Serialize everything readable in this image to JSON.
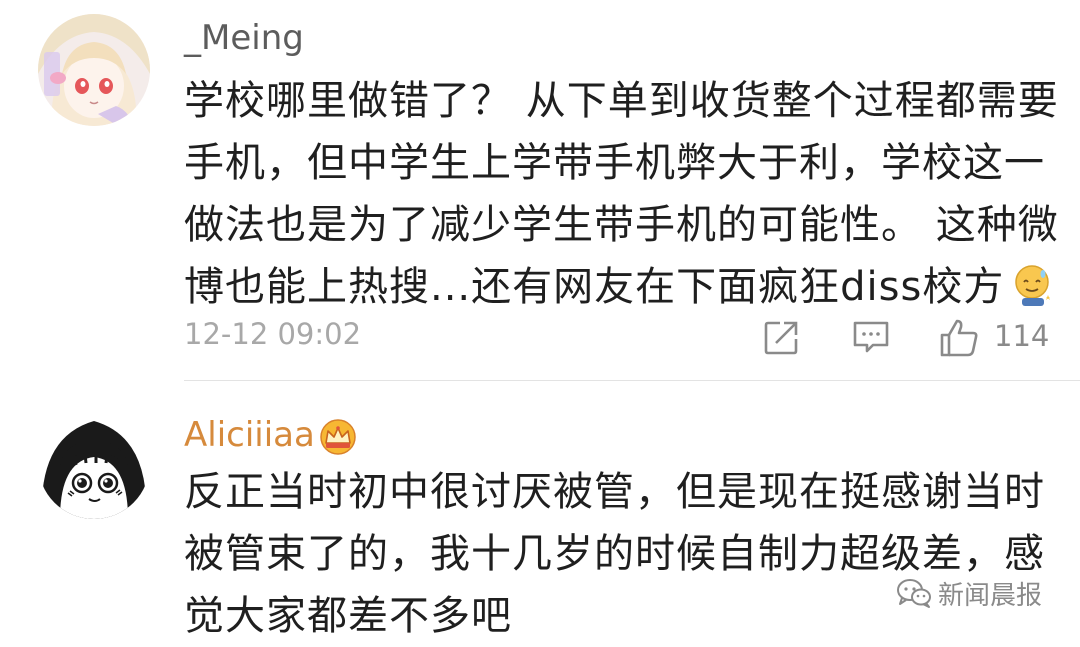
{
  "comments": [
    {
      "username": "_Meing",
      "text_lines": [
        "学校哪里做错了？ 从下单到收货整个过程都需要",
        "手机，但中学生上学带手机弊大于利，学校这一",
        "做法也是为了减少学生带手机的可能性。 这种微",
        "博也能上热搜...还有网友在下面疯狂diss校方"
      ],
      "timestamp": "12-12 09:02",
      "like_count": "114",
      "emoji": "sweat-smile-emoji"
    },
    {
      "username": "Aliciiiaa",
      "badge": "vip-crown-icon",
      "text_lines": [
        "反正当时初中很讨厌被管，但是现在挺感谢当时",
        "被管束了的，我十几岁的时候自制力超级差，感",
        "觉大家都差不多吧"
      ]
    }
  ],
  "watermark": {
    "text": "新闻晨报",
    "icon": "wechat-icon"
  },
  "colors": {
    "username_regular": "#5c5c5c",
    "username_vip": "#d68a3c",
    "meta_gray": "#a8a8a8"
  }
}
